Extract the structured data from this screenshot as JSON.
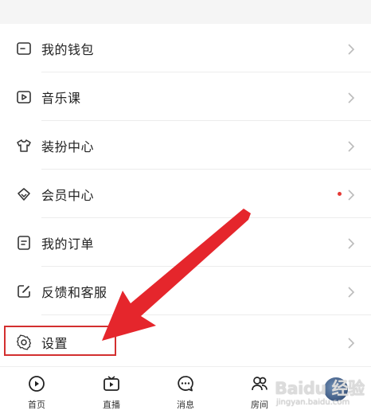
{
  "menu": {
    "items": [
      {
        "label": "我的钱包",
        "icon": "wallet-icon"
      },
      {
        "label": "音乐课",
        "icon": "play-square-icon"
      },
      {
        "label": "装扮中心",
        "icon": "tshirt-icon"
      },
      {
        "label": "会员中心",
        "icon": "vip-diamond-icon",
        "has_dot": true
      },
      {
        "label": "我的订单",
        "icon": "order-list-icon"
      },
      {
        "label": "反馈和客服",
        "icon": "feedback-edit-icon"
      },
      {
        "label": "设置",
        "icon": "gear-icon"
      }
    ]
  },
  "tabbar": {
    "tabs": [
      {
        "label": "首页",
        "icon": "home-play-icon"
      },
      {
        "label": "直播",
        "icon": "tv-live-icon"
      },
      {
        "label": "消息",
        "icon": "chat-bubble-icon"
      },
      {
        "label": "房间",
        "icon": "users-icon"
      }
    ]
  },
  "watermark": {
    "text": "Baidu 经验",
    "sub": "jingyan.baidu.com"
  },
  "colors": {
    "annotation": "#e5262c",
    "dot": "#e53935"
  }
}
